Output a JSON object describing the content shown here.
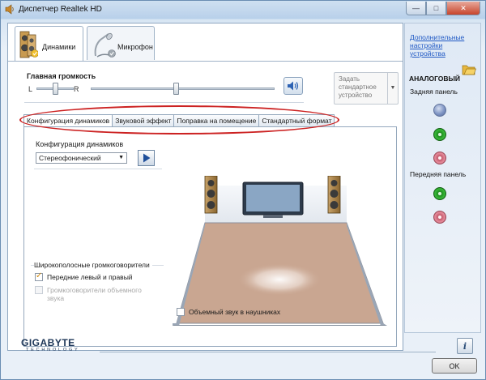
{
  "window": {
    "title": "Диспетчер Realtek HD",
    "minimize": "—",
    "maximize": "□",
    "close": "✕"
  },
  "device_tabs": [
    {
      "label": "Динамики",
      "icon": "speakers-icon",
      "active": true
    },
    {
      "label": "Микрофон",
      "icon": "microphone-icon",
      "active": false
    }
  ],
  "volume": {
    "title": "Главная громкость",
    "left": "L",
    "right": "R",
    "balance_level": 0.5,
    "volume_level": 0.48
  },
  "default_device": {
    "label": "Задать стандартное устройство"
  },
  "tabs": [
    {
      "label": "Конфигурация динамиков",
      "active": true
    },
    {
      "label": "Звуковой эффект",
      "active": false
    },
    {
      "label": "Поправка на помещение",
      "active": false
    },
    {
      "label": "Стандартный формат",
      "active": false
    }
  ],
  "speaker_config": {
    "label": "Конфигурация динамиков",
    "selected": "Стереофонический"
  },
  "wideband": {
    "title": "Широкополосные громкоговорители",
    "front": "Передние левый и правый",
    "surround": "Громкоговорители объемного звука"
  },
  "headphones": {
    "label": "Объемный звук в наушниках"
  },
  "right_panel": {
    "advanced_link": "Дополнительные настройки устройства",
    "analog": "АНАЛОГОВЫЙ",
    "rear_panel": "Задняя панель",
    "front_panel": "Передняя панель"
  },
  "footer": {
    "brand": "GIGABYTE",
    "brand_sub": "TECHNOLOGY",
    "info": "i",
    "ok": "OK"
  },
  "colors": {
    "accent_link": "#1f58c4",
    "highlight_oval": "#cc2222",
    "floor": "#c9a691",
    "jack_blue": "#7f95c4",
    "jack_green": "#38b838",
    "jack_pink": "#e58a9a"
  }
}
